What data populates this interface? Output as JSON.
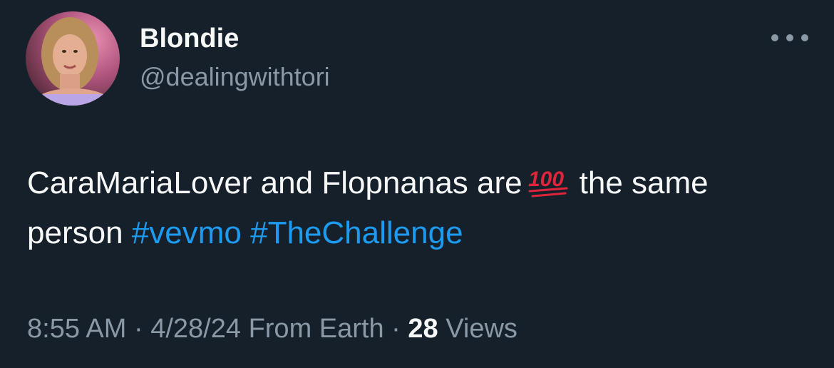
{
  "author": {
    "display_name": "Blondie",
    "handle": "@dealingwithtori",
    "avatar_icon": "profile-photo"
  },
  "more_icon": "ellipsis-icon",
  "tweet": {
    "line1_text": "CaraMariaLover and Flopnanas are",
    "emoji": "💯",
    "line1_after": "the same",
    "line2_text": "person",
    "hashtags": [
      "#vevmo",
      "#TheChallenge"
    ]
  },
  "meta": {
    "time": "8:55 AM",
    "separator": "·",
    "date": "4/28/24",
    "source": "From Earth",
    "views_count": "28",
    "views_label": "Views"
  },
  "colors": {
    "background": "#15202b",
    "text_primary": "#f7f9f9",
    "text_secondary": "#8b98a5",
    "link": "#1d9bf0"
  }
}
